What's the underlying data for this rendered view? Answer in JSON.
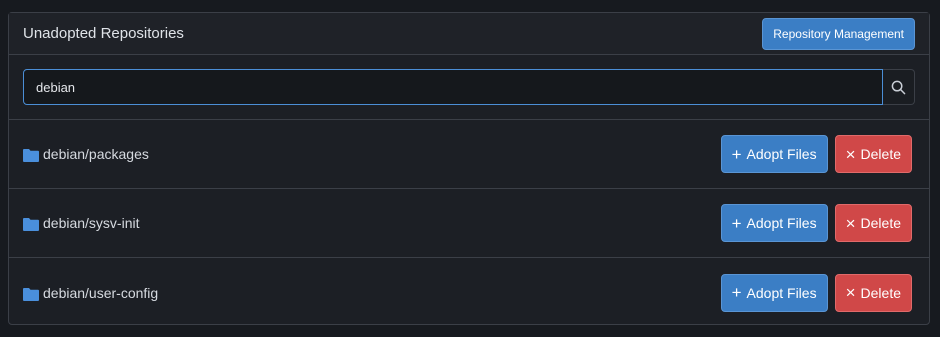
{
  "header": {
    "title": "Unadopted Repositories",
    "manage_label": "Repository Management"
  },
  "search": {
    "value": "debian",
    "icon": "search-icon"
  },
  "repos": [
    {
      "name": "debian/packages",
      "adopt_label": "Adopt Files",
      "delete_label": "Delete"
    },
    {
      "name": "debian/sysv-init",
      "adopt_label": "Adopt Files",
      "delete_label": "Delete"
    },
    {
      "name": "debian/user-config",
      "adopt_label": "Adopt Files",
      "delete_label": "Delete"
    }
  ],
  "colors": {
    "primary": "#3b7ec5",
    "danger": "#d04848",
    "folder": "#4a8fdc"
  }
}
